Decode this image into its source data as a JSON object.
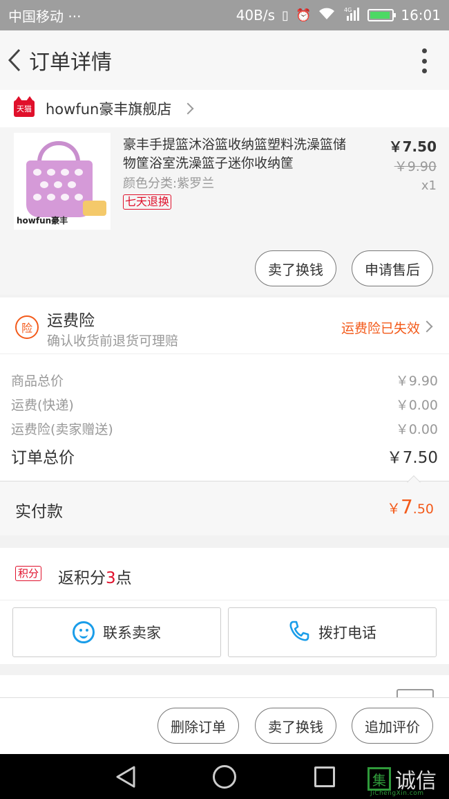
{
  "status_bar": {
    "carrier": "中国移动",
    "dots": "···",
    "net_speed": "40B/s",
    "network": "4G",
    "time": "16:01"
  },
  "header": {
    "title": "订单详情"
  },
  "shop": {
    "badge": "天猫",
    "name": "howfun豪丰旗舰店"
  },
  "item": {
    "title": "豪丰手提篮沐浴篮收纳篮塑料洗澡篮储物筐浴室洗澡篮子迷你收纳筐",
    "sku": "颜色分类:紫罗兰",
    "return_tag": "七天退换",
    "price": "￥7.50",
    "original_price": "￥9.90",
    "quantity": "x1",
    "image_brand": "howfun豪丰",
    "btn_sell": "卖了换钱",
    "btn_after_sale": "申请售后"
  },
  "insurance": {
    "icon_label": "险",
    "title": "运费险",
    "subtitle": "确认收货前退货可理赔",
    "status": "运费险已失效"
  },
  "summary": {
    "rows": [
      {
        "label": "商品总价",
        "value": "￥9.90"
      },
      {
        "label": "运费(快递)",
        "value": "￥0.00"
      },
      {
        "label": "运费险(卖家赠送)",
        "value": "￥0.00"
      }
    ],
    "total_label": "订单总价",
    "total_value": "￥7.50"
  },
  "paid": {
    "label": "实付款",
    "currency": "￥",
    "integer": "7",
    "decimal": ".50"
  },
  "points": {
    "tag": "积分",
    "prefix": "返积分",
    "count": "3",
    "suffix": "点"
  },
  "contact": {
    "seller": "联系卖家",
    "call": "拨打电话"
  },
  "bottom_actions": {
    "delete": "删除订单",
    "sell": "卖了换钱",
    "review": "追加评价"
  },
  "watermark": {
    "mark": "集",
    "text": "诚信",
    "url": "JiChengXin.com"
  },
  "colors": {
    "accent_orange": "#f35a1a",
    "tmall_red": "#e0102b",
    "contact_blue": "#1a9de9"
  }
}
